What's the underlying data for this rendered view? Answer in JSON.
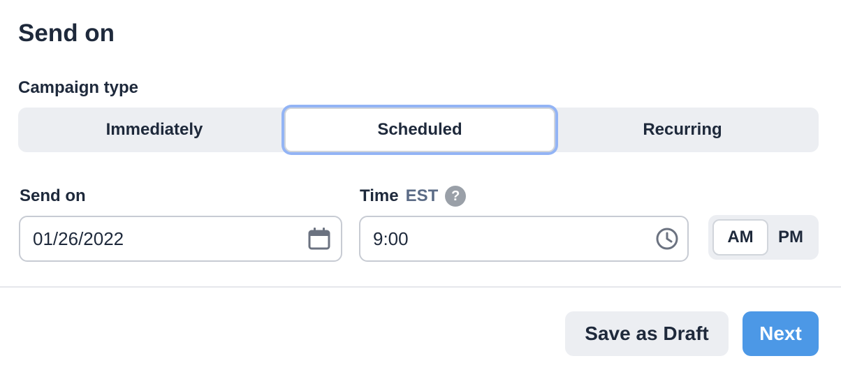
{
  "header": {
    "title": "Send on"
  },
  "campaign_type": {
    "label": "Campaign type",
    "options": [
      "Immediately",
      "Scheduled",
      "Recurring"
    ],
    "selected": "Scheduled"
  },
  "send_on": {
    "label": "Send on",
    "value": "01/26/2022",
    "icon": "calendar-icon"
  },
  "time": {
    "label": "Time",
    "timezone": "EST",
    "help": "?",
    "value": "9:00",
    "icon": "clock-icon",
    "am": "AM",
    "pm": "PM",
    "selected_period": "AM"
  },
  "footer": {
    "draft_label": "Save as Draft",
    "next_label": "Next"
  },
  "colors": {
    "accent": "#4c98e6",
    "focus_ring": "#93b4f5",
    "segment_bg": "#eceef2"
  }
}
